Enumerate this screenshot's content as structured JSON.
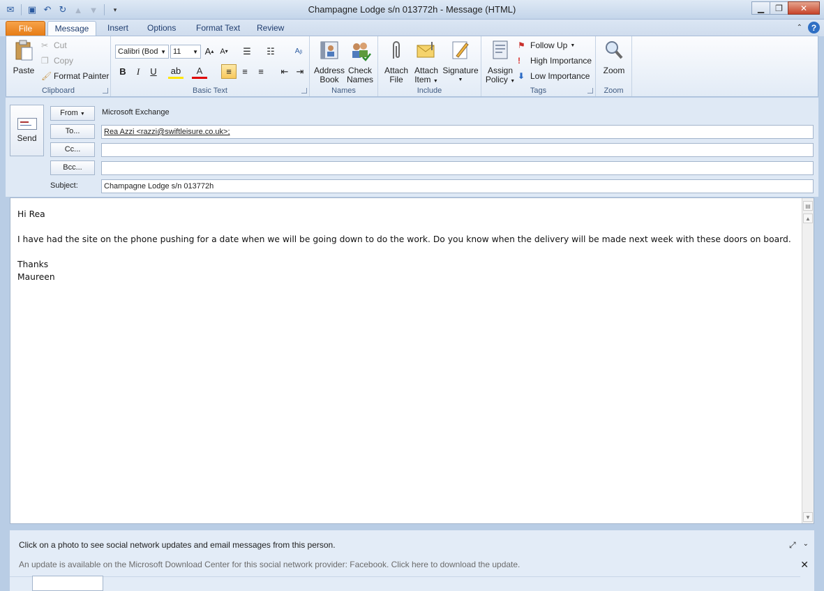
{
  "window": {
    "title": "Champagne Lodge  s/n  013772h  -  Message (HTML)"
  },
  "tabs": [
    {
      "label": "File"
    },
    {
      "label": "Message"
    },
    {
      "label": "Insert"
    },
    {
      "label": "Options"
    },
    {
      "label": "Format Text"
    },
    {
      "label": "Review"
    }
  ],
  "ribbon": {
    "clipboard": {
      "group_label": "Clipboard",
      "paste": "Paste",
      "cut": "Cut",
      "copy": "Copy",
      "format_painter": "Format Painter"
    },
    "basic_text": {
      "group_label": "Basic Text",
      "font_name": "Calibri (Bod",
      "font_size": "11"
    },
    "names": {
      "group_label": "Names",
      "address_book_1": "Address",
      "address_book_2": "Book",
      "check_names_1": "Check",
      "check_names_2": "Names"
    },
    "include": {
      "group_label": "Include",
      "attach_file_1": "Attach",
      "attach_file_2": "File",
      "attach_item_1": "Attach",
      "attach_item_2": "Item",
      "signature": "Signature"
    },
    "tags": {
      "group_label": "Tags",
      "assign_policy_1": "Assign",
      "assign_policy_2": "Policy",
      "follow_up": "Follow Up",
      "high_importance": "High Importance",
      "low_importance": "Low Importance"
    },
    "zoom": {
      "group_label": "Zoom",
      "zoom": "Zoom"
    }
  },
  "header": {
    "send_label": "Send",
    "from_label": "From",
    "from_value": "Microsoft Exchange",
    "to_label": "To...",
    "to_value": "Rea Azzi <razzi@swiftleisure.co.uk>;",
    "cc_label": "Cc...",
    "cc_value": "",
    "bcc_label": "Bcc...",
    "bcc_value": "",
    "subject_label": "Subject:",
    "subject_value": "Champagne Lodge  s/n  013772h"
  },
  "body": {
    "lines": [
      "Hi Rea",
      "",
      "I have had the site on the phone pushing for a date when we will be going down to do the work.  Do you know when the delivery will be made next week with these doors on board.",
      "",
      "Thanks",
      "Maureen"
    ]
  },
  "people_pane": {
    "info": "Click on a photo to see social network updates and email messages from this person.",
    "update_notice": "An update is available on the Microsoft Download Center for this social network provider: Facebook. Click here to download the update."
  },
  "colors": {
    "file_tab": "#e57a13",
    "accent_blue": "#2a5aa0",
    "close_button": "#c7442a"
  }
}
